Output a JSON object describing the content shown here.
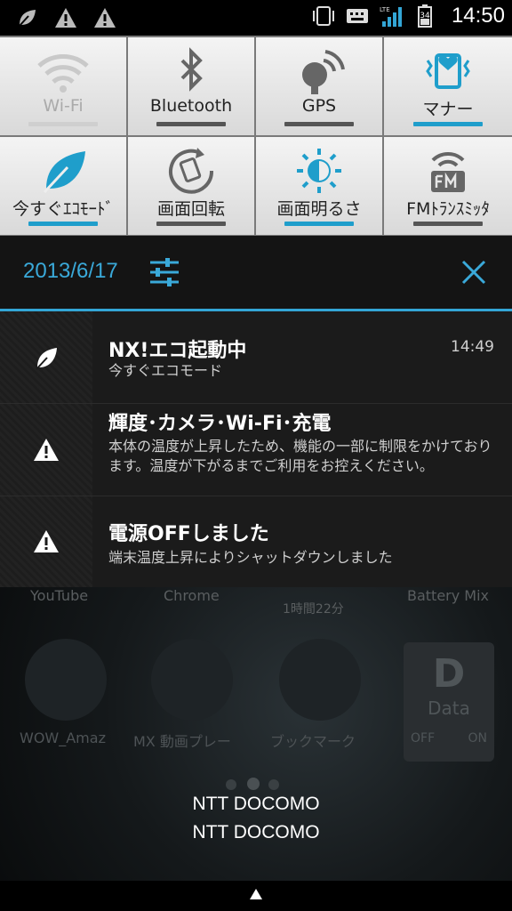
{
  "status_bar": {
    "time": "14:50",
    "battery_level": "34",
    "network": "LTE",
    "left_icons": [
      "leaf-icon",
      "warning-icon",
      "warning-icon"
    ],
    "right_icons": [
      "manner-mode-icon",
      "keyboard-icon",
      "lte-signal-icon",
      "battery-icon"
    ]
  },
  "quick_settings": {
    "tiles": [
      {
        "label": "Wi-Fi",
        "icon": "wifi-icon",
        "state": "off"
      },
      {
        "label": "Bluetooth",
        "icon": "bluetooth-icon",
        "state": "off"
      },
      {
        "label": "GPS",
        "icon": "gps-icon",
        "state": "off"
      },
      {
        "label": "マナー",
        "icon": "manner-icon",
        "state": "on"
      },
      {
        "label": "今すぐｴｺﾓｰﾄﾞ",
        "icon": "eco-leaf-icon",
        "state": "on"
      },
      {
        "label": "画面回転",
        "icon": "rotate-icon",
        "state": "off"
      },
      {
        "label": "画面明るさ",
        "icon": "brightness-icon",
        "state": "on"
      },
      {
        "label": "FMﾄﾗﾝｽﾐｯﾀ",
        "icon": "fm-transmitter-icon",
        "state": "off"
      }
    ]
  },
  "header": {
    "date": "2013/6/17"
  },
  "notifications": [
    {
      "title": "NX!エコ起動中",
      "text": "今すぐエコモード",
      "time": "14:49",
      "icon": "leaf-icon"
    },
    {
      "title": "輝度･カメラ･Wi-Fi･充電",
      "text": "本体の温度が上昇したため、機能の一部に制限をかけております。温度が下がるまでご利用をお控えください。",
      "icon": "warning-icon"
    },
    {
      "title": "電源OFFしました",
      "text": "端末温度上昇によりシャットダウンしました",
      "icon": "warning-icon"
    }
  ],
  "home_screen": {
    "labels_row1": [
      "YouTube",
      "Chrome",
      "1時間22分",
      "Battery Mix"
    ],
    "apps_row2": [
      "WOW_Amaz",
      "MX 動画プレー",
      "ブックマーク"
    ],
    "data_widget": {
      "title": "D",
      "subtitle": "Data",
      "off": "OFF",
      "on": "ON"
    }
  },
  "carrier": {
    "line1": "NTT DOCOMO",
    "line2": "NTT DOCOMO"
  },
  "colors": {
    "accent": "#33a6d6",
    "tile_bg": "#e6e6e6",
    "notif_bg": "#1b1b1b"
  }
}
